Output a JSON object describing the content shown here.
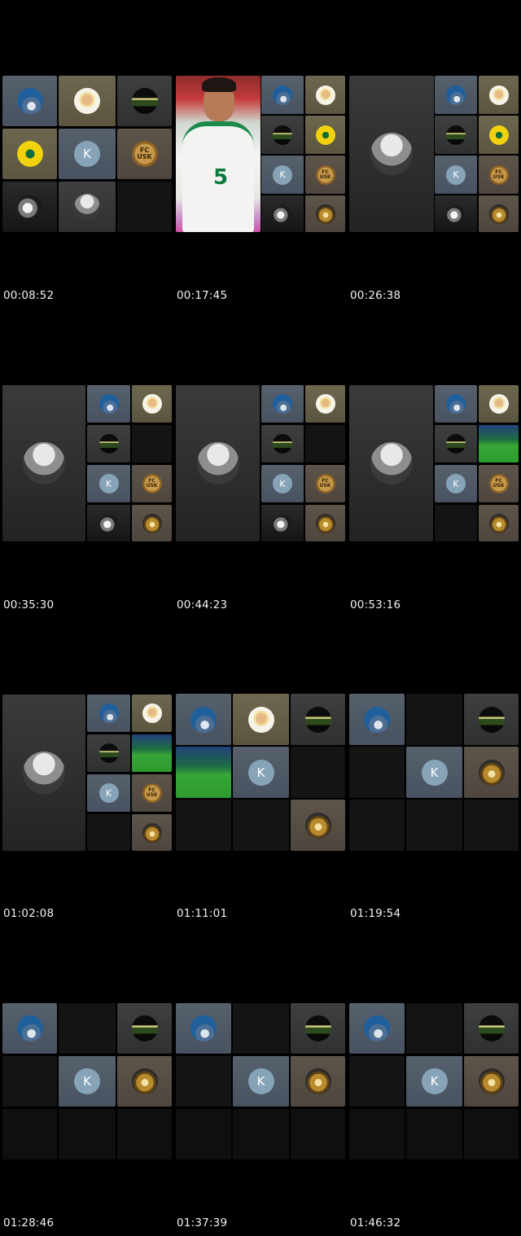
{
  "timestamps": [
    "00:08:52",
    "00:17:45",
    "00:26:38",
    "00:35:30",
    "00:44:23",
    "00:53:16",
    "01:02:08",
    "01:11:01",
    "01:19:54",
    "01:28:46",
    "01:37:39",
    "01:46:32"
  ],
  "avatar_letter": "K",
  "badge_text_line1": "FC",
  "badge_text_line2": "USK",
  "jersey_number": "5",
  "icons": {
    "hand": "raised-hand-icon",
    "face": "player-face-icon",
    "stadium": "stadium-icon",
    "crest": "jsk-crest-icon",
    "letter": "letter-avatar-icon",
    "badge": "club-badge-icon",
    "eagle": "eagle-icon",
    "crowd": "crowd-icon",
    "gold": "golden-ball-icon",
    "pitch": "pitch-video-tile"
  },
  "colors": {
    "background": "#000000",
    "timestamp": "#f2f2f2",
    "letter_avatar": "#86a3b8"
  }
}
